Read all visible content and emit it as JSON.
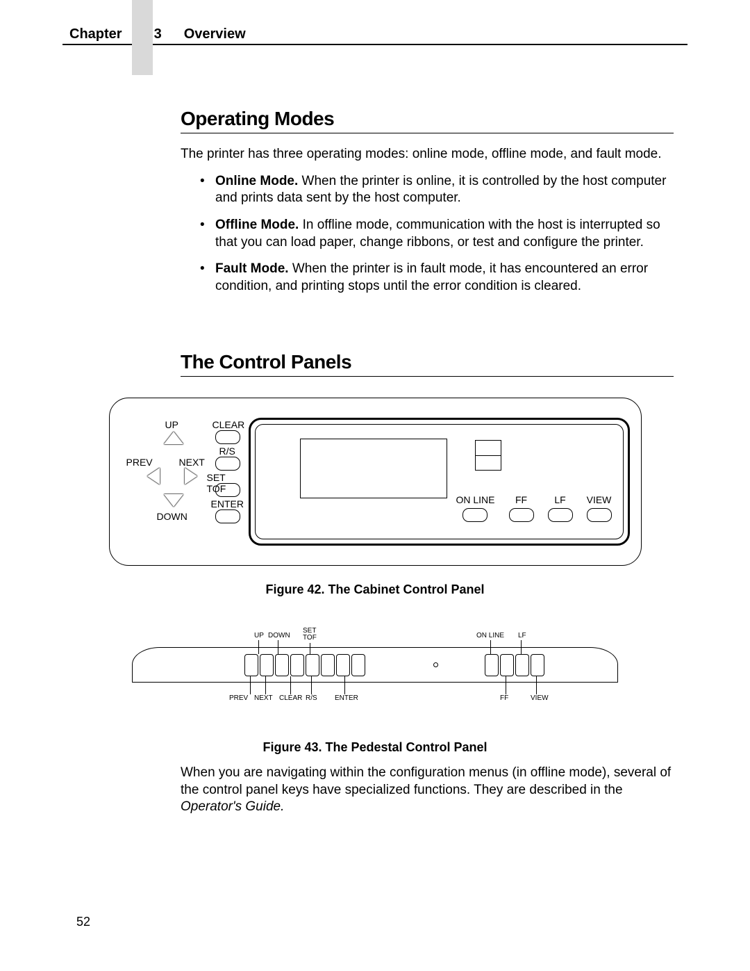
{
  "header": {
    "chapter": "Chapter",
    "num": "3",
    "title": "Overview"
  },
  "section1": {
    "heading": "Operating Modes",
    "intro": "The printer has three operating modes: online mode, offline mode, and fault mode.",
    "items": [
      {
        "term": "Online Mode.",
        "text": " When the printer is online, it is controlled by the host computer and prints data sent by the host computer."
      },
      {
        "term": "Offline Mode.",
        "text": " In offline mode, communication with the host is interrupted so that you can load paper, change ribbons, or test and configure the printer."
      },
      {
        "term": "Fault Mode.",
        "text": " When the printer is in fault mode, it has encountered an error condition, and printing stops until the error condition is cleared."
      }
    ]
  },
  "section2": {
    "heading": "The Control Panels"
  },
  "cabinet": {
    "up": "UP",
    "down": "DOWN",
    "prev": "PREV",
    "next": "NEXT",
    "clear": "CLEAR",
    "rs": "R/S",
    "settof": "SET TOF",
    "enter": "ENTER",
    "online": "ON LINE",
    "ff": "FF",
    "lf": "LF",
    "view": "VIEW"
  },
  "fig42": "Figure 42. The Cabinet Control Panel",
  "pedestal": {
    "up": "UP",
    "down": "DOWN",
    "settof": "SET\nTOF",
    "prev": "PREV",
    "next": "NEXT",
    "clear": "CLEAR",
    "rs": "R/S",
    "enter": "ENTER",
    "online": "ON LINE",
    "lf": "LF",
    "ff": "FF",
    "view": "VIEW"
  },
  "fig43": "Figure 43. The Pedestal Control Panel",
  "closing": {
    "pre": "When you are navigating within the configuration menus (in offline mode), several of the control panel keys have specialized functions. They are described in the ",
    "em": "Operator's Guide."
  },
  "page": "52"
}
